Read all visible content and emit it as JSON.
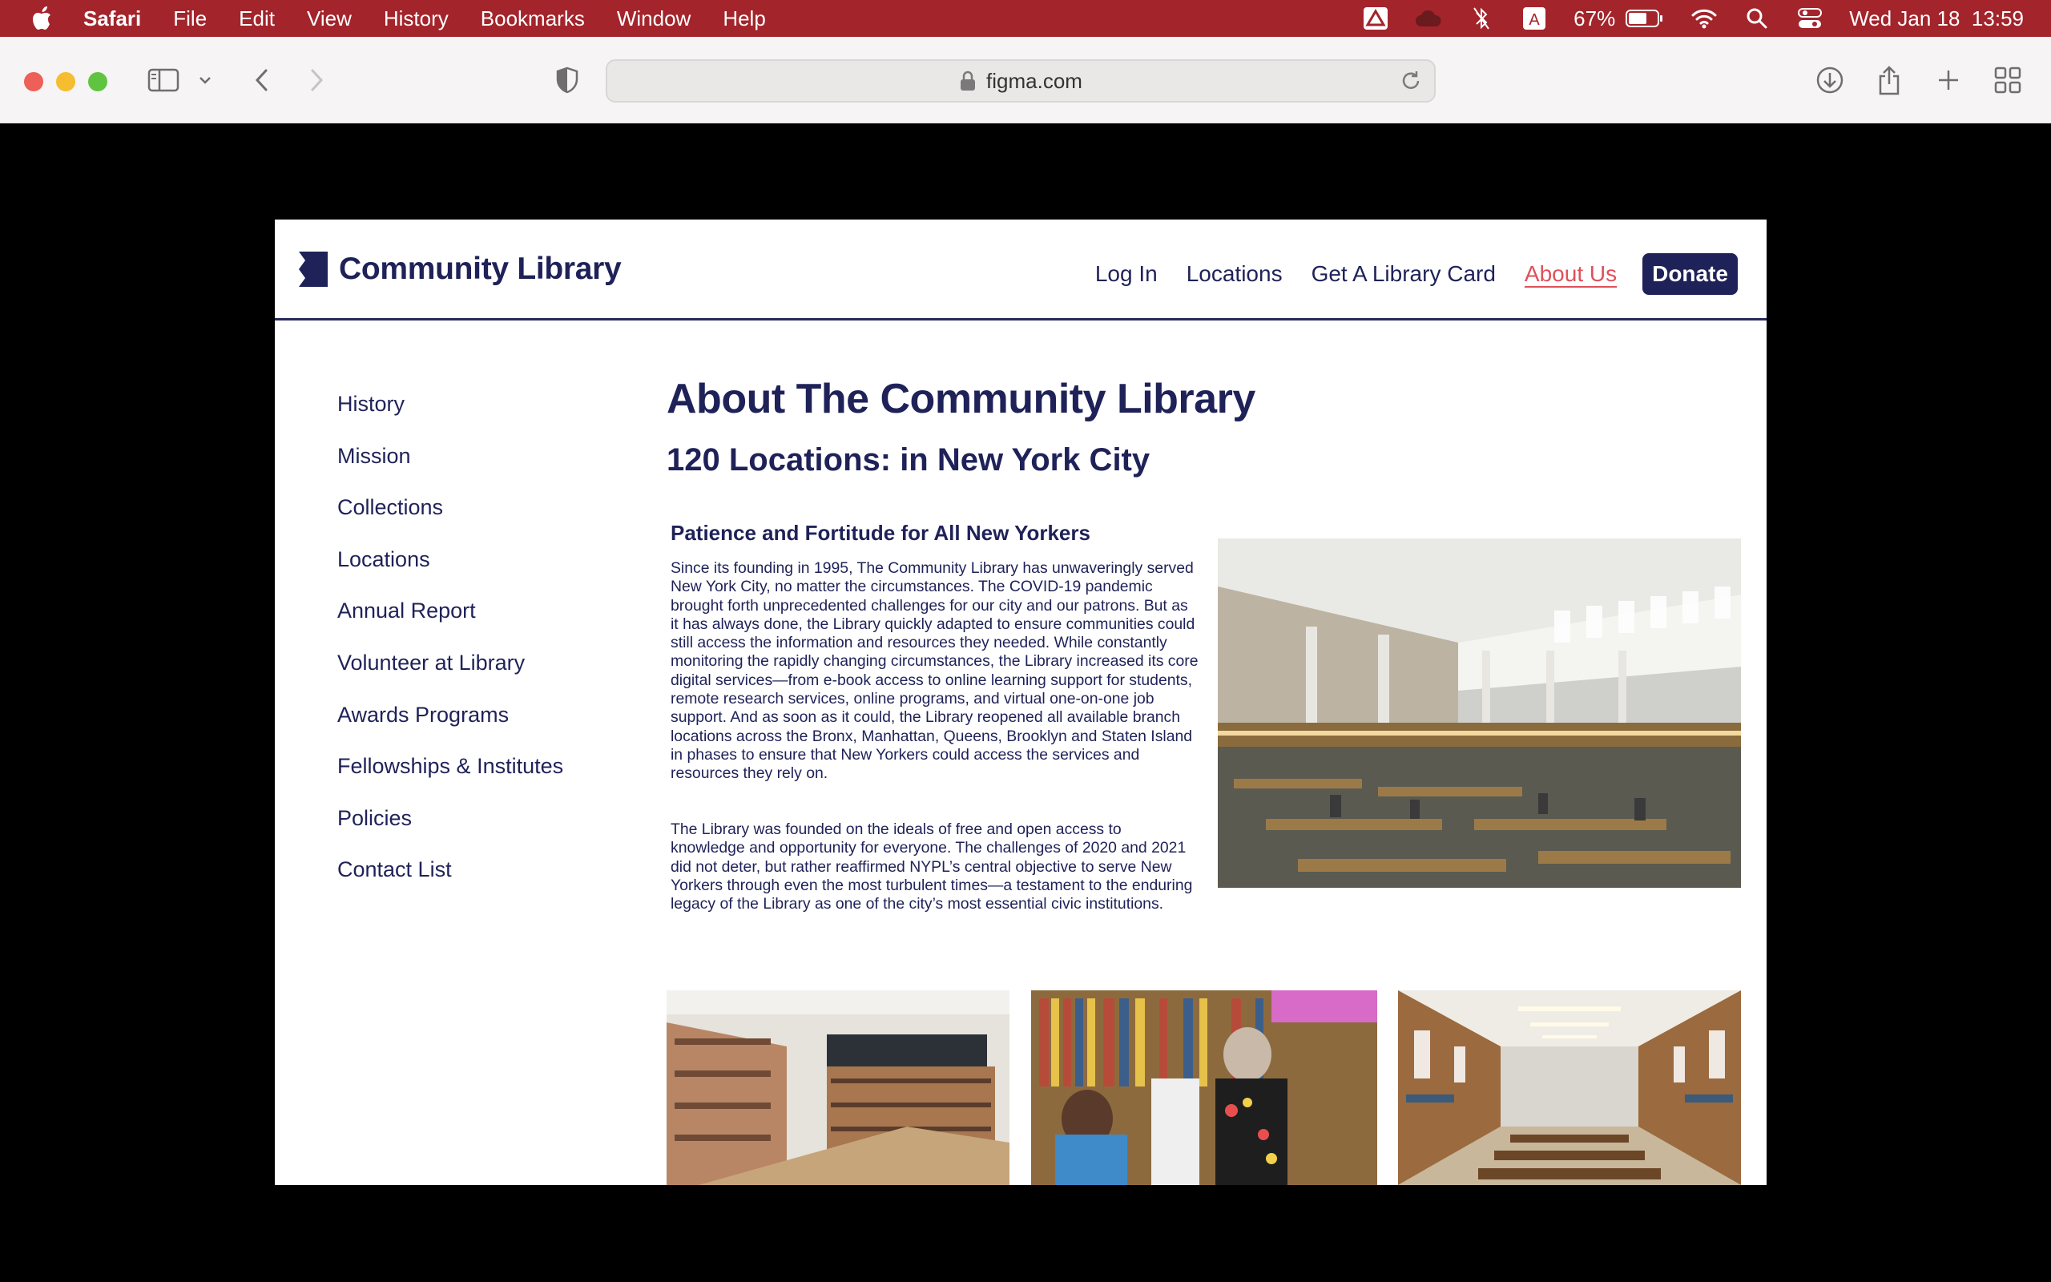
{
  "menubar": {
    "app_name": "Safari",
    "items": [
      "File",
      "Edit",
      "View",
      "History",
      "Bookmarks",
      "Window",
      "Help"
    ],
    "battery": "67%",
    "datetime": "Wed Jan 18  13:59",
    "color": "#a3242b"
  },
  "browser": {
    "url": "figma.com"
  },
  "site": {
    "logo_text": "Community Library",
    "brand_color": "#1f2258",
    "accent_color": "#e0505a",
    "nav": {
      "login": "Log In",
      "locations": "Locations",
      "library_card": "Get A Library Card",
      "about": "About Us",
      "donate": "Donate"
    },
    "sidebar": [
      "History",
      "Mission",
      "Collections",
      "Locations",
      "Annual Report",
      "Volunteer at Library",
      "Awards Programs",
      "Fellowships & Institutes",
      "Policies",
      "Contact List"
    ],
    "title": "About The Community Library",
    "subtitle": "120 Locations: in New York City",
    "section_heading": "Patience and Fortitude for All New Yorkers",
    "paragraph1": "Since its founding in 1995, The Community Library has unwaveringly served New York City, no matter the circumstances. The COVID-19 pandemic brought forth unprecedented challenges for our city and our patrons. But as it has always done, the Library quickly adapted to ensure communities could still access the information and resources they needed. While constantly monitoring the rapidly changing circumstances, the Library increased its core digital services—from e-book access to online learning support for students, remote research services, online programs, and virtual one-on-one job support. And as soon as it could, the Library reopened all available branch locations across the Bronx, Manhattan, Queens, Brooklyn and Staten Island in phases to ensure that New Yorkers could access the services and resources they rely on.",
    "paragraph2": "The Library was founded on the ideals of free and open access to knowledge and opportunity for everyone. The challenges of 2020 and 2021 did not deter, but rather reaffirmed NYPL’s central objective to serve New Yorkers through even the most turbulent times—a testament to the enduring legacy of the Library as one of the city’s most essential civic institutions."
  }
}
